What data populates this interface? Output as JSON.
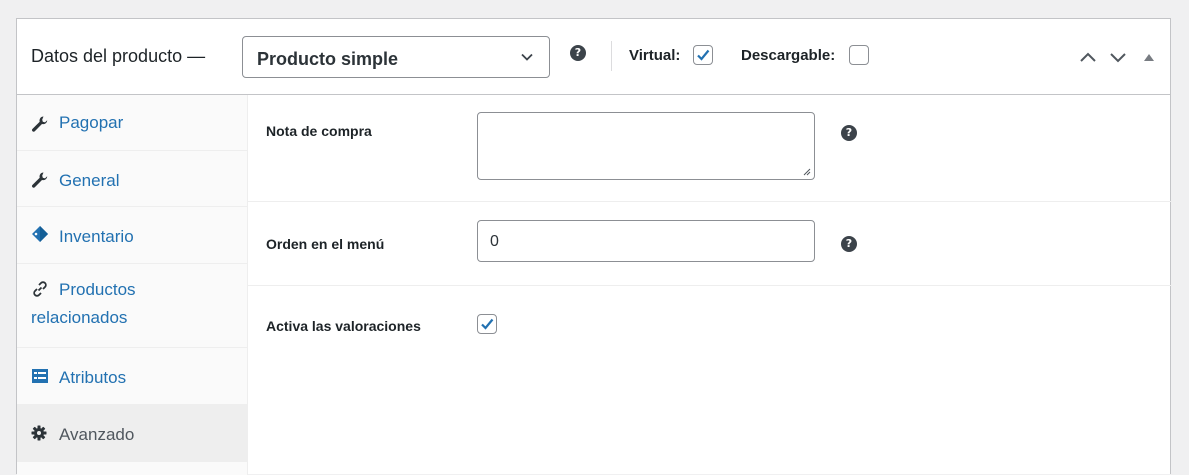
{
  "header": {
    "title": "Datos del producto —",
    "product_type_select": {
      "selected": "Producto simple"
    },
    "virtual": {
      "label": "Virtual:",
      "checked": true
    },
    "downloadable": {
      "label": "Descargable:",
      "checked": false
    }
  },
  "tabs": [
    {
      "label": "Pagopar",
      "icon": "wrench-icon",
      "active": false
    },
    {
      "label": "General",
      "icon": "wrench-icon",
      "active": false
    },
    {
      "label": "Inventario",
      "icon": "tag-icon",
      "active": false
    },
    {
      "label_line1": "Productos",
      "label_line2": "relacionados",
      "icon": "link-icon",
      "active": false
    },
    {
      "label": "Atributos",
      "icon": "list-icon",
      "active": false
    },
    {
      "label": "Avanzado",
      "icon": "gear-icon",
      "active": true
    }
  ],
  "fields": {
    "purchase_note": {
      "label": "Nota de compra",
      "value": ""
    },
    "menu_order": {
      "label": "Orden en el menú",
      "value": "0"
    },
    "reviews": {
      "label": "Activa las valoraciones",
      "checked": true
    }
  },
  "colors": {
    "accent": "#2271b1",
    "border": "#c3c4c7",
    "active_tab_bg": "#eeeeee",
    "page_bg": "#f0f0f1"
  }
}
